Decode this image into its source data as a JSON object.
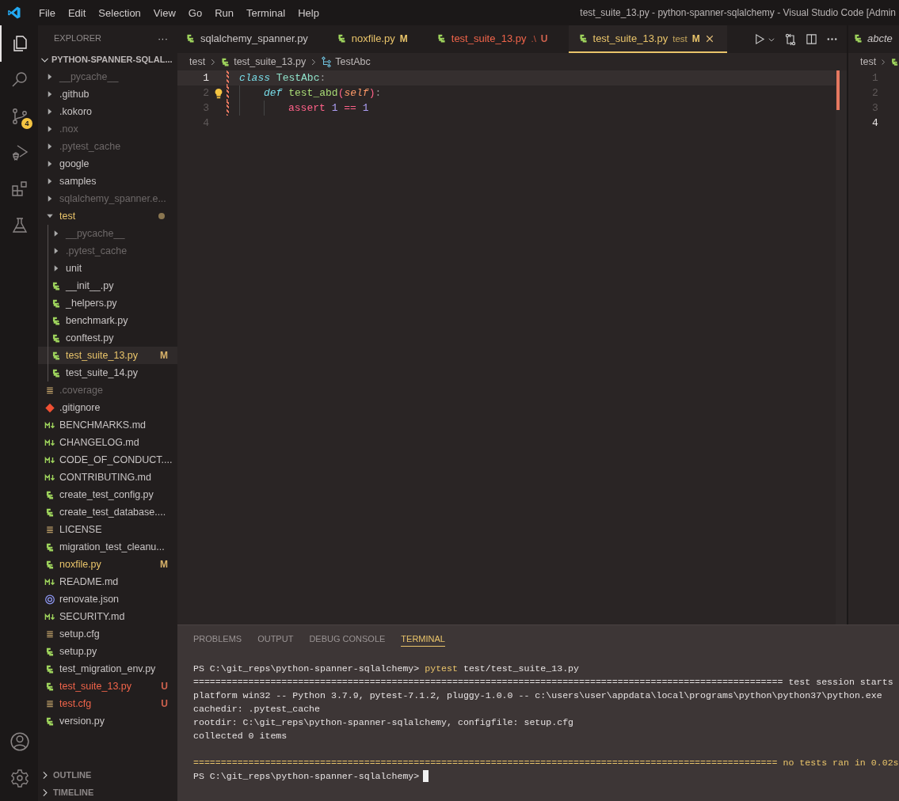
{
  "menu": [
    "File",
    "Edit",
    "Selection",
    "View",
    "Go",
    "Run",
    "Terminal",
    "Help"
  ],
  "window": {
    "title": "test_suite_13.py - python-spanner-sqlalchemy - Visual Studio Code [Admin"
  },
  "activity_bar": [
    {
      "kind": "explorer",
      "selected": true
    },
    {
      "kind": "search",
      "selected": false
    },
    {
      "kind": "source-control",
      "selected": false,
      "badge": "4"
    },
    {
      "kind": "run-debug",
      "selected": false
    },
    {
      "kind": "extensions",
      "selected": false
    },
    {
      "kind": "testing",
      "selected": false
    }
  ],
  "activity_bottom": [
    {
      "kind": "account"
    },
    {
      "kind": "settings"
    }
  ],
  "sidebar": {
    "title": "EXPLORER",
    "more": "···",
    "section": {
      "label": "PYTHON-SPANNER-SQLAL...",
      "expanded": true
    },
    "tree": [
      {
        "name": "__pycache__",
        "kind": "folder",
        "expanded": false,
        "dimmed": true,
        "modified": false,
        "untracked": false,
        "selected": false
      },
      {
        "name": ".github",
        "kind": "folder",
        "expanded": false,
        "dimmed": false,
        "modified": false,
        "untracked": false,
        "selected": false
      },
      {
        "name": ".kokoro",
        "kind": "folder",
        "expanded": false,
        "dimmed": false,
        "modified": false,
        "untracked": false,
        "selected": false
      },
      {
        "name": ".nox",
        "kind": "folder",
        "expanded": false,
        "dimmed": true,
        "modified": false,
        "untracked": false,
        "selected": false
      },
      {
        "name": ".pytest_cache",
        "kind": "folder",
        "expanded": false,
        "dimmed": true,
        "modified": false,
        "untracked": false,
        "selected": false
      },
      {
        "name": "google",
        "kind": "folder",
        "expanded": false,
        "dimmed": false,
        "modified": false,
        "untracked": false,
        "selected": false
      },
      {
        "name": "samples",
        "kind": "folder",
        "expanded": false,
        "dimmed": false,
        "modified": false,
        "untracked": false,
        "selected": false
      },
      {
        "name": "sqlalchemy_spanner.e...",
        "kind": "folder",
        "expanded": false,
        "dimmed": true,
        "modified": false,
        "untracked": false,
        "selected": false
      },
      {
        "name": "test",
        "kind": "folder",
        "expanded": true,
        "dimmed": false,
        "modified": true,
        "untracked": false,
        "selected": false,
        "children": [
          {
            "name": "__pycache__",
            "kind": "folder",
            "expanded": false,
            "dimmed": true,
            "modified": false,
            "untracked": false,
            "selected": false
          },
          {
            "name": ".pytest_cache",
            "kind": "folder",
            "expanded": false,
            "dimmed": true,
            "modified": false,
            "untracked": false,
            "selected": false
          },
          {
            "name": "unit",
            "kind": "folder",
            "expanded": false,
            "dimmed": false,
            "modified": false,
            "untracked": false,
            "selected": false
          },
          {
            "name": "__init__.py",
            "kind": "python",
            "dimmed": false,
            "modified": false,
            "untracked": false,
            "selected": false
          },
          {
            "name": "_helpers.py",
            "kind": "python",
            "dimmed": false,
            "modified": false,
            "untracked": false,
            "selected": false
          },
          {
            "name": "benchmark.py",
            "kind": "python",
            "dimmed": false,
            "modified": false,
            "untracked": false,
            "selected": false
          },
          {
            "name": "conftest.py",
            "kind": "python",
            "dimmed": false,
            "modified": false,
            "untracked": false,
            "selected": false
          },
          {
            "name": "test_suite_13.py",
            "kind": "python",
            "dimmed": false,
            "modified": true,
            "untracked": false,
            "badge": "M",
            "selected": true
          },
          {
            "name": "test_suite_14.py",
            "kind": "python",
            "dimmed": false,
            "modified": false,
            "untracked": false,
            "selected": false
          }
        ]
      },
      {
        "name": ".coverage",
        "kind": "text",
        "dimmed": true,
        "modified": false,
        "untracked": false,
        "selected": false
      },
      {
        "name": ".gitignore",
        "kind": "git",
        "dimmed": false,
        "modified": false,
        "untracked": false,
        "selected": false
      },
      {
        "name": "BENCHMARKS.md",
        "kind": "markdown",
        "dimmed": false,
        "modified": false,
        "untracked": false,
        "selected": false
      },
      {
        "name": "CHANGELOG.md",
        "kind": "markdown",
        "dimmed": false,
        "modified": false,
        "untracked": false,
        "selected": false
      },
      {
        "name": "CODE_OF_CONDUCT....",
        "kind": "markdown",
        "dimmed": false,
        "modified": false,
        "untracked": false,
        "selected": false
      },
      {
        "name": "CONTRIBUTING.md",
        "kind": "markdown",
        "dimmed": false,
        "modified": false,
        "untracked": false,
        "selected": false
      },
      {
        "name": "create_test_config.py",
        "kind": "python",
        "dimmed": false,
        "modified": false,
        "untracked": false,
        "selected": false
      },
      {
        "name": "create_test_database....",
        "kind": "python",
        "dimmed": false,
        "modified": false,
        "untracked": false,
        "selected": false
      },
      {
        "name": "LICENSE",
        "kind": "text",
        "dimmed": false,
        "modified": false,
        "untracked": false,
        "selected": false
      },
      {
        "name": "migration_test_cleanu...",
        "kind": "python",
        "dimmed": false,
        "modified": false,
        "untracked": false,
        "selected": false
      },
      {
        "name": "noxfile.py",
        "kind": "python",
        "dimmed": false,
        "modified": true,
        "untracked": false,
        "badge": "M",
        "selected": false
      },
      {
        "name": "README.md",
        "kind": "markdown",
        "dimmed": false,
        "modified": false,
        "untracked": false,
        "selected": false
      },
      {
        "name": "renovate.json",
        "kind": "json",
        "dimmed": false,
        "modified": false,
        "untracked": false,
        "selected": false
      },
      {
        "name": "SECURITY.md",
        "kind": "markdown",
        "dimmed": false,
        "modified": false,
        "untracked": false,
        "selected": false
      },
      {
        "name": "setup.cfg",
        "kind": "text",
        "dimmed": false,
        "modified": false,
        "untracked": false,
        "selected": false
      },
      {
        "name": "setup.py",
        "kind": "python",
        "dimmed": false,
        "modified": false,
        "untracked": false,
        "selected": false
      },
      {
        "name": "test_migration_env.py",
        "kind": "python",
        "dimmed": false,
        "modified": false,
        "untracked": false,
        "selected": false
      },
      {
        "name": "test_suite_13.py",
        "kind": "python",
        "dimmed": false,
        "modified": false,
        "untracked": true,
        "badge": "U",
        "selected": false
      },
      {
        "name": "test.cfg",
        "kind": "text",
        "dimmed": false,
        "modified": false,
        "untracked": true,
        "badge": "U",
        "selected": false
      },
      {
        "name": "version.py",
        "kind": "python",
        "dimmed": false,
        "modified": false,
        "untracked": false,
        "selected": false
      }
    ],
    "bottom_sections": [
      {
        "label": "OUTLINE",
        "expanded": false
      },
      {
        "label": "TIMELINE",
        "expanded": false
      }
    ]
  },
  "tabs": [
    {
      "label": "sqlalchemy_spanner.py",
      "modified": false,
      "untracked": false,
      "selected": false
    },
    {
      "label": "noxfile.py",
      "modified": true,
      "untracked": false,
      "badge": "M",
      "selected": false
    },
    {
      "label": "test_suite_13.py",
      "description": ".\\",
      "modified": false,
      "untracked": true,
      "badge": "U",
      "selected": false
    },
    {
      "label": "test_suite_13.py",
      "description": "test",
      "modified": true,
      "untracked": false,
      "badge": "M",
      "selected": true
    }
  ],
  "breadcrumb": [
    {
      "label": "test",
      "kind": "folder"
    },
    {
      "label": "test_suite_13.py",
      "kind": "python"
    },
    {
      "label": "TestAbc",
      "kind": "class"
    }
  ],
  "code": [
    {
      "number": "1",
      "current": true,
      "changed": true,
      "lightbulb": false,
      "words": [
        [
          {
            "text": "class",
            "kind": "keyword"
          }
        ],
        [
          {
            "text": "TestAbc",
            "kind": "class"
          },
          {
            "text": ":",
            "kind": "punct"
          }
        ]
      ],
      "children": [
        {
          "number": "2",
          "current": false,
          "changed": true,
          "lightbulb": true,
          "words": [
            [
              {
                "text": "def",
                "kind": "keyword"
              }
            ],
            [
              {
                "text": "test_abd",
                "kind": "function"
              },
              {
                "text": "(",
                "kind": "paren"
              },
              {
                "text": "self",
                "kind": "param"
              },
              {
                "text": ")",
                "kind": "paren"
              },
              {
                "text": ":",
                "kind": "punct"
              }
            ]
          ],
          "children": [
            {
              "number": "3",
              "current": false,
              "changed": true,
              "lightbulb": false,
              "words": [
                [
                  {
                    "text": "assert",
                    "kind": "control"
                  }
                ],
                [
                  {
                    "text": "1",
                    "kind": "number"
                  }
                ],
                [
                  {
                    "text": "==",
                    "kind": "operator"
                  }
                ],
                [
                  {
                    "text": "1",
                    "kind": "number"
                  }
                ]
              ]
            }
          ]
        }
      ]
    },
    {
      "number": "4",
      "current": false,
      "changed": false,
      "lightbulb": false
    }
  ],
  "second_group": {
    "tab": {
      "label": "abcte",
      "deleted": true
    },
    "breadcrumb": "test",
    "lines": [
      {
        "number": "1",
        "current": false
      },
      {
        "number": "2",
        "current": false
      },
      {
        "number": "3",
        "current": false
      },
      {
        "number": "4",
        "current": true
      }
    ]
  },
  "panel": {
    "tabs": [
      {
        "label": "PROBLEMS",
        "selected": false
      },
      {
        "label": "OUTPUT",
        "selected": false
      },
      {
        "label": "DEBUG CONSOLE",
        "selected": false
      },
      {
        "label": "TERMINAL",
        "selected": true
      }
    ],
    "blocks": [
      [
        [
          {
            "text": "PS C:\\git_reps\\python-spanner-sqlalchemy> ",
            "kind": "plain"
          },
          {
            "text": "pytest",
            "kind": "command"
          },
          {
            "text": " test/test_suite_13.py",
            "kind": "plain"
          }
        ],
        [
          {
            "text": "=========================================================================================================== test session starts",
            "kind": "plain"
          }
        ],
        [
          {
            "text": "platform win32 -- Python 3.7.9, pytest-7.1.2, pluggy-1.0.0 -- c:\\users\\user\\appdata\\local\\programs\\python\\python37\\python.exe",
            "kind": "plain"
          }
        ],
        [
          {
            "text": "cachedir: .pytest_cache",
            "kind": "plain"
          }
        ],
        [
          {
            "text": "rootdir: C:\\git_reps\\python-spanner-sqlalchemy, configfile: setup.cfg",
            "kind": "plain"
          }
        ],
        [
          {
            "text": "collected 0 items",
            "kind": "plain"
          }
        ]
      ],
      [
        [
          {
            "text": "========================================================================================================== no tests ran in 0.02s",
            "kind": "warning"
          }
        ],
        [
          {
            "text": "PS C:\\git_reps\\python-spanner-sqlalchemy>",
            "kind": "plain"
          }
        ]
      ]
    ],
    "cursor": true
  }
}
